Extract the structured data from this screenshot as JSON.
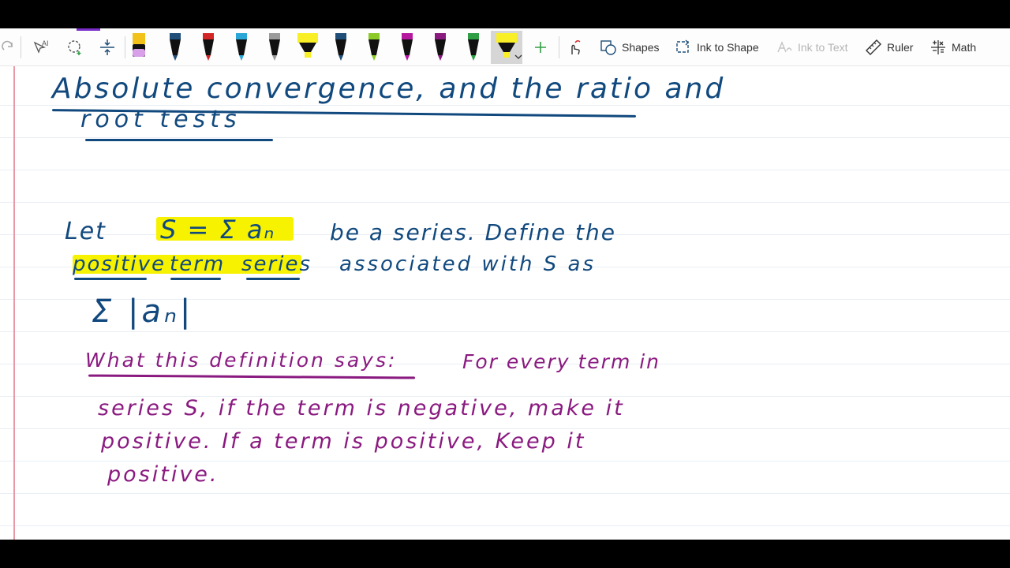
{
  "toolbar": {
    "tools": [
      {
        "name": "redo",
        "icon": "redo-icon"
      },
      {
        "name": "type",
        "icon": "text-cursor-icon"
      },
      {
        "name": "lasso",
        "icon": "lasso-icon"
      },
      {
        "name": "space",
        "icon": "add-space-icon"
      }
    ],
    "pens": [
      {
        "color": "#f2c21a",
        "kind": "highlighter-pink"
      },
      {
        "color": "#1f4e79",
        "kind": "pen"
      },
      {
        "color": "#d32626",
        "kind": "pen"
      },
      {
        "color": "#2aa7d6",
        "kind": "pen"
      },
      {
        "color": "#9a9a9a",
        "kind": "pen"
      },
      {
        "color": "#f8ef26",
        "kind": "highlighter"
      },
      {
        "color": "#1f4e79",
        "kind": "pen"
      },
      {
        "color": "#8ac926",
        "kind": "pen"
      },
      {
        "color": "#b5179e",
        "kind": "pen"
      },
      {
        "color": "#8a1a80",
        "kind": "pen"
      },
      {
        "color": "#2f9e44",
        "kind": "pen"
      },
      {
        "color": "#f8ef26",
        "kind": "highlighter-selected"
      }
    ],
    "buttons": {
      "shapes": "Shapes",
      "ink_to_shape": "Ink to Shape",
      "ink_to_text": "Ink to Text",
      "ruler": "Ruler",
      "math": "Math"
    }
  },
  "note": {
    "title_line1": "Absolute convergence, and the ratio and",
    "title_line2": "root tests",
    "def_let": "Let",
    "def_series": "S = Σ aₙ",
    "def_rest1": "be a series. Define the",
    "def_term1": "positive",
    "def_term2": "term",
    "def_term3": "series",
    "def_rest2": "associated with S as",
    "def_formula": "Σ |aₙ|",
    "explain_heading": "What this definition says:",
    "explain_line1": "For every term in",
    "explain_line2": "series S, if the term is negative, make it",
    "explain_line3": "positive. If a term is positive, Keep it",
    "explain_line4": "positive."
  }
}
